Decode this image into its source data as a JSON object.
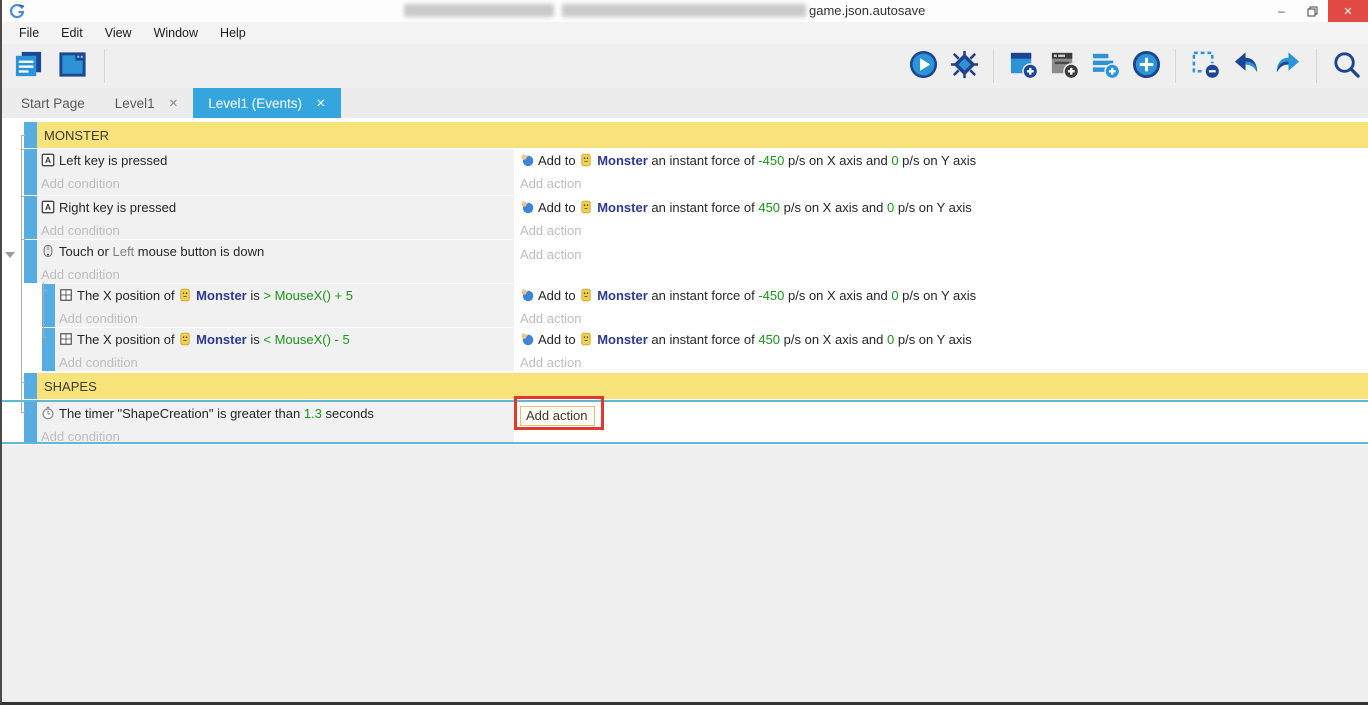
{
  "titlebar": {
    "title": "game.json.autosave"
  },
  "glyphs": {
    "minimize": "–",
    "close": "✕"
  },
  "menu": {
    "items": [
      "File",
      "Edit",
      "View",
      "Window",
      "Help"
    ]
  },
  "toolbar": {
    "left": [
      {
        "icon": "project-manager-icon"
      },
      {
        "icon": "scene-editor-icon"
      },
      {
        "sep": true
      }
    ],
    "right": [
      {
        "icon": "play-icon"
      },
      {
        "icon": "debugger-icon"
      },
      {
        "sep": true
      },
      {
        "icon": "add-event-icon"
      },
      {
        "icon": "add-subevent-icon"
      },
      {
        "icon": "add-comment-icon"
      },
      {
        "icon": "add-circle-icon"
      },
      {
        "sep": true
      },
      {
        "icon": "deselect-icon"
      },
      {
        "icon": "undo-icon"
      },
      {
        "icon": "redo-icon"
      },
      {
        "sep": true
      },
      {
        "icon": "search-icon"
      }
    ]
  },
  "tabs": [
    {
      "label": "Start Page",
      "active": false,
      "closable": false
    },
    {
      "label": "Level1",
      "active": false,
      "closable": true
    },
    {
      "label": "Level1 (Events)",
      "active": true,
      "closable": true
    }
  ],
  "events": {
    "add_condition_label": "Add condition",
    "add_action_label": "Add action",
    "items": [
      {
        "type": "group",
        "id": "monster",
        "label": "MONSTER",
        "level": 0,
        "height": 26
      },
      {
        "type": "event",
        "id": "left-key",
        "level": 0,
        "height": 46,
        "condition": {
          "icon": "keyboard-icon",
          "segments": [
            {
              "text": "Left key is pressed",
              "kind": "plain"
            }
          ]
        },
        "action": {
          "icon": "force-icon",
          "segments": [
            {
              "text": "Add to ",
              "kind": "plain"
            },
            {
              "text": "Monster",
              "kind": "object",
              "icon": "monster-icon"
            },
            {
              "text": " an instant force of ",
              "kind": "plain"
            },
            {
              "text": "-450",
              "kind": "value"
            },
            {
              "text": " p/s on X axis and ",
              "kind": "plain"
            },
            {
              "text": "0",
              "kind": "value"
            },
            {
              "text": " p/s on Y axis",
              "kind": "plain"
            }
          ]
        }
      },
      {
        "type": "event",
        "id": "right-key",
        "level": 0,
        "height": 43,
        "condition": {
          "icon": "keyboard-icon",
          "segments": [
            {
              "text": "Right key is pressed",
              "kind": "plain"
            }
          ]
        },
        "action": {
          "icon": "force-icon",
          "segments": [
            {
              "text": "Add to ",
              "kind": "plain"
            },
            {
              "text": "Monster",
              "kind": "object",
              "icon": "monster-icon"
            },
            {
              "text": " an instant force of ",
              "kind": "plain"
            },
            {
              "text": "450",
              "kind": "value"
            },
            {
              "text": " p/s on X axis and ",
              "kind": "plain"
            },
            {
              "text": "0",
              "kind": "value"
            },
            {
              "text": " p/s on Y axis",
              "kind": "plain"
            }
          ]
        }
      },
      {
        "type": "event",
        "id": "touch-mouse",
        "level": 0,
        "height": 43,
        "condition": {
          "icon": "mouse-icon",
          "segments": [
            {
              "text": "Touch or ",
              "kind": "plain"
            },
            {
              "text": "Left",
              "kind": "param"
            },
            {
              "text": " mouse button is down",
              "kind": "plain"
            }
          ]
        },
        "action": null
      },
      {
        "type": "event",
        "id": "xpos-greater",
        "level": 1,
        "height": 43,
        "condition": {
          "icon": "position-icon",
          "segments": [
            {
              "text": "The X position of ",
              "kind": "plain"
            },
            {
              "text": "Monster",
              "kind": "object",
              "icon": "monster-icon"
            },
            {
              "text": " is ",
              "kind": "plain"
            },
            {
              "text": "> MouseX() + 5",
              "kind": "value"
            }
          ]
        },
        "action": {
          "icon": "force-icon",
          "segments": [
            {
              "text": "Add to ",
              "kind": "plain"
            },
            {
              "text": "Monster",
              "kind": "object",
              "icon": "monster-icon"
            },
            {
              "text": " an instant force of ",
              "kind": "plain"
            },
            {
              "text": "-450",
              "kind": "value"
            },
            {
              "text": " p/s on X axis and ",
              "kind": "plain"
            },
            {
              "text": "0",
              "kind": "value"
            },
            {
              "text": " p/s on Y axis",
              "kind": "plain"
            }
          ]
        }
      },
      {
        "type": "event",
        "id": "xpos-less",
        "level": 1,
        "height": 43,
        "condition": {
          "icon": "position-icon",
          "segments": [
            {
              "text": "The X position of ",
              "kind": "plain"
            },
            {
              "text": "Monster",
              "kind": "object",
              "icon": "monster-icon"
            },
            {
              "text": " is ",
              "kind": "plain"
            },
            {
              "text": "< MouseX() - 5",
              "kind": "value"
            }
          ]
        },
        "action": {
          "icon": "force-icon",
          "segments": [
            {
              "text": "Add to ",
              "kind": "plain"
            },
            {
              "text": "Monster",
              "kind": "object",
              "icon": "monster-icon"
            },
            {
              "text": " an instant force of ",
              "kind": "plain"
            },
            {
              "text": "450",
              "kind": "value"
            },
            {
              "text": " p/s on X axis and ",
              "kind": "plain"
            },
            {
              "text": "0",
              "kind": "value"
            },
            {
              "text": " p/s on Y axis",
              "kind": "plain"
            }
          ]
        }
      },
      {
        "type": "group",
        "id": "shapes",
        "label": "SHAPES",
        "level": 0,
        "height": 26,
        "gap_before": 2
      },
      {
        "type": "event",
        "id": "timer-shapecreation",
        "level": 0,
        "height": 44,
        "selected": true,
        "condition": {
          "icon": "timer-icon",
          "segments": [
            {
              "text": "The timer \"ShapeCreation\" is greater than ",
              "kind": "plain"
            },
            {
              "text": "1.3",
              "kind": "value"
            },
            {
              "text": " seconds",
              "kind": "plain"
            }
          ]
        },
        "action": {
          "annotated_add_action": true
        }
      }
    ]
  },
  "colors": {
    "accent_blue": "#35a5de",
    "event_bar_blue": "#57ace2",
    "group_yellow": "#f8e27a",
    "value_green": "#1b941b",
    "object_blue": "#2d3a94",
    "annotation_red": "#e3382c",
    "close_button_red": "#e14b44"
  }
}
